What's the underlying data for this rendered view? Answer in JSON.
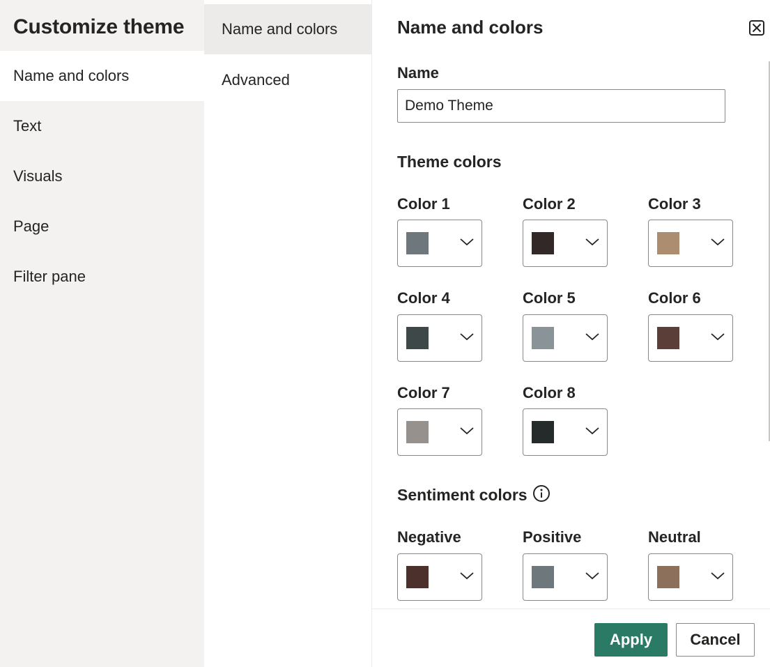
{
  "sidebar": {
    "title": "Customize theme",
    "items": [
      {
        "label": "Name and colors",
        "active": true
      },
      {
        "label": "Text"
      },
      {
        "label": "Visuals"
      },
      {
        "label": "Page"
      },
      {
        "label": "Filter pane"
      }
    ]
  },
  "subnav": {
    "items": [
      {
        "label": "Name and colors",
        "active": true
      },
      {
        "label": "Advanced"
      }
    ]
  },
  "panel": {
    "title": "Name and colors",
    "close_icon": "close-icon",
    "name_label": "Name",
    "name_value": "Demo Theme",
    "theme_colors_title": "Theme colors",
    "theme_colors": [
      {
        "label": "Color 1",
        "color": "#6e787c"
      },
      {
        "label": "Color 2",
        "color": "#332828"
      },
      {
        "label": "Color 3",
        "color": "#ad8d70"
      },
      {
        "label": "Color 4",
        "color": "#3e4848"
      },
      {
        "label": "Color 5",
        "color": "#8a9498"
      },
      {
        "label": "Color 6",
        "color": "#5a3e37"
      },
      {
        "label": "Color 7",
        "color": "#96918c"
      },
      {
        "label": "Color 8",
        "color": "#252a2b"
      }
    ],
    "sentiment_title": "Sentiment colors",
    "sentiment_icon": "info-icon",
    "sentiment_colors": [
      {
        "label": "Negative",
        "color": "#4b302c"
      },
      {
        "label": "Positive",
        "color": "#6e787c"
      },
      {
        "label": "Neutral",
        "color": "#8d705c"
      }
    ]
  },
  "footer": {
    "apply_label": "Apply",
    "cancel_label": "Cancel",
    "apply_color": "#2b7a66"
  }
}
